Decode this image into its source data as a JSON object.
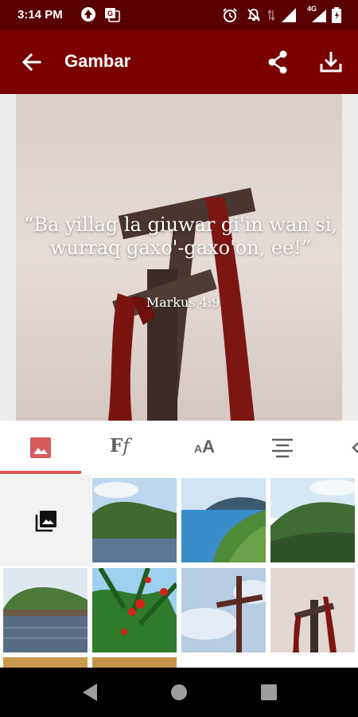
{
  "status_bar": {
    "time": "3:14 PM",
    "network_label": "4G",
    "left_icons": [
      "notification-app-icon",
      "translate-icon"
    ],
    "right_icons": [
      "alarm-icon",
      "mute-icon",
      "data-arrows-icon",
      "signal-icon",
      "signal-4g-icon",
      "battery-icon"
    ]
  },
  "app_bar": {
    "title": "Gambar",
    "back_icon": "arrow-back-icon",
    "share_icon": "share-icon",
    "download_icon": "download-icon",
    "background_color": "#7b0000"
  },
  "preview": {
    "verse_text": "“Ba yillag la giuwar gi'in wan si, wurraq gaxo'-gaxo'on, ee!”",
    "verse_reference": "Markus 4:9",
    "background_image": "wooden-cross-with-red-cloth-photo"
  },
  "tabs": [
    {
      "name": "background-image-tab",
      "icon": "image-icon",
      "selected": true
    },
    {
      "name": "font-family-tab",
      "icon": "font-family-icon",
      "label": "Ff",
      "selected": false
    },
    {
      "name": "font-size-tab",
      "icon": "text-size-icon",
      "label": "AA",
      "selected": false
    },
    {
      "name": "text-align-tab",
      "icon": "align-center-icon",
      "selected": false
    },
    {
      "name": "more-tab",
      "icon": "partial-icon",
      "selected": false
    }
  ],
  "accent_color": "#d75a5a",
  "image_grid": {
    "picker_icon": "photo-library-icon",
    "thumbnails": [
      "green-hills-by-water",
      "coastline-aerial",
      "green-mountain-valley",
      "small-island",
      "red-flowers-tree",
      "cross-against-sky",
      "cross-with-red-cloth",
      "golden-sky-1",
      "golden-sky-2"
    ]
  },
  "nav_bar": {
    "back_icon": "nav-back-icon",
    "home_icon": "nav-home-icon",
    "recents_icon": "nav-recents-icon"
  }
}
